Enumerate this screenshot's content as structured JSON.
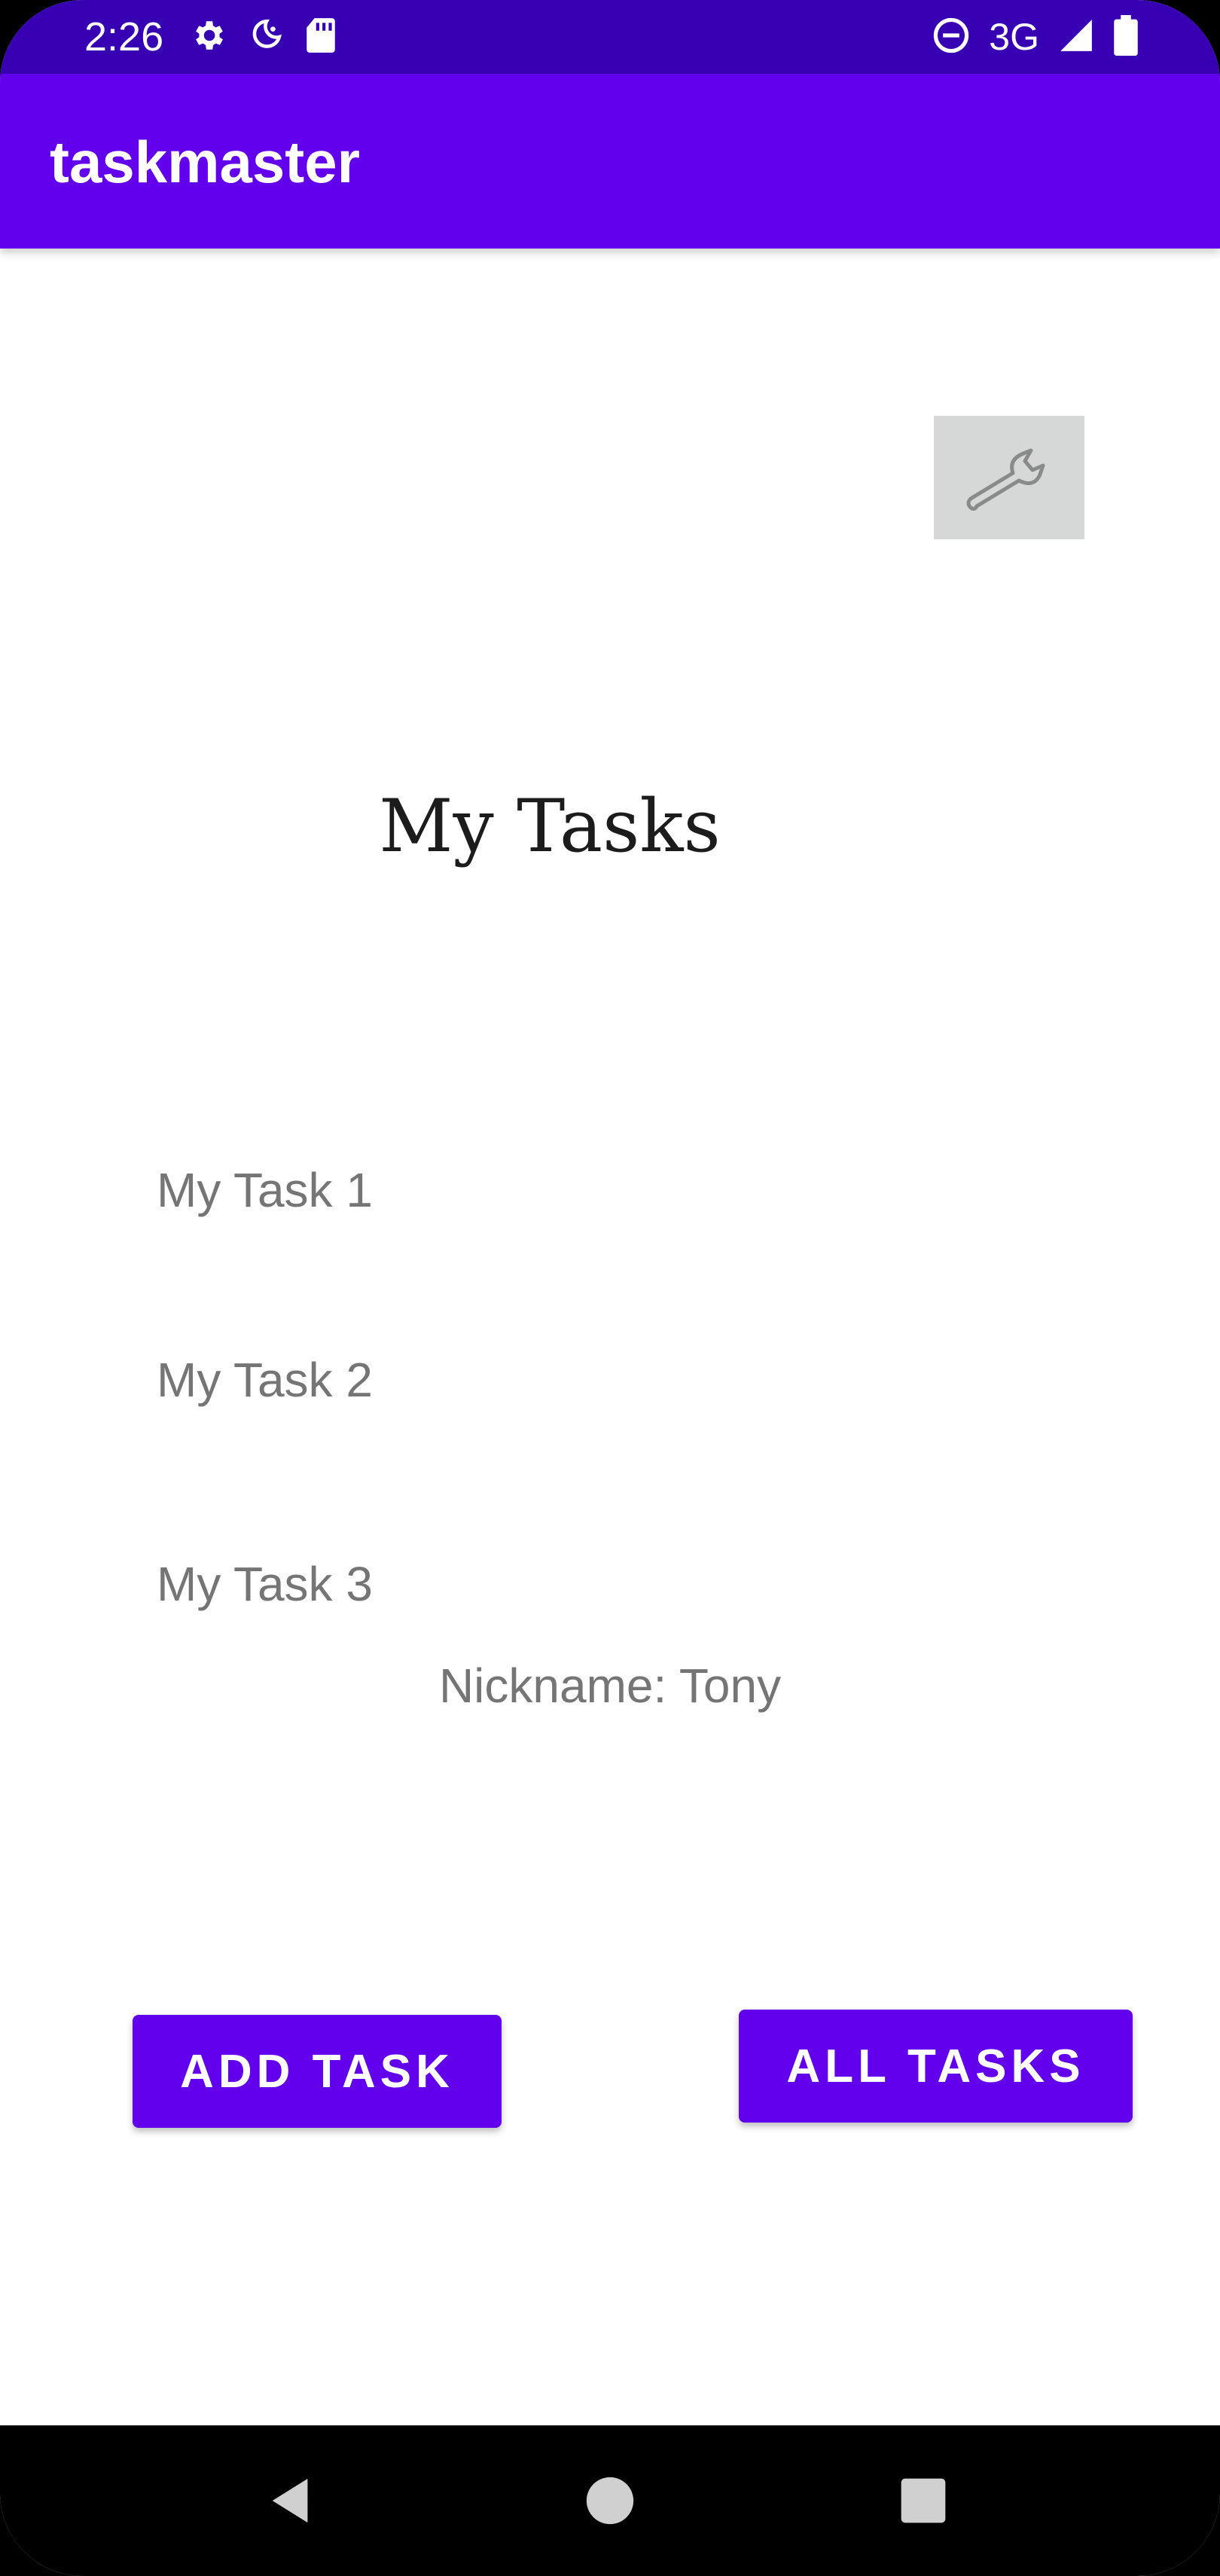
{
  "status_bar": {
    "time": "2:26",
    "network": "3G",
    "icons": [
      "settings-icon",
      "do-not-disturb-moon-icon",
      "sd-card-icon",
      "dnd-circle-icon",
      "signal-icon",
      "battery-icon"
    ]
  },
  "app_bar": {
    "title": "taskmaster"
  },
  "main": {
    "settings_icon": "wrench-icon",
    "page_title": "My Tasks",
    "tasks": [
      {
        "label": "My Task 1"
      },
      {
        "label": "My Task 2"
      },
      {
        "label": "My Task 3"
      }
    ],
    "nickname": "Nickname: Tony",
    "add_task_label": "ADD TASK",
    "all_tasks_label": "ALL TASKS"
  },
  "nav_bar": {
    "icons": [
      "back-icon",
      "home-icon",
      "recents-icon"
    ]
  },
  "colors": {
    "status_bar": "#3700b3",
    "primary": "#6200ee",
    "text_secondary": "#757575"
  }
}
